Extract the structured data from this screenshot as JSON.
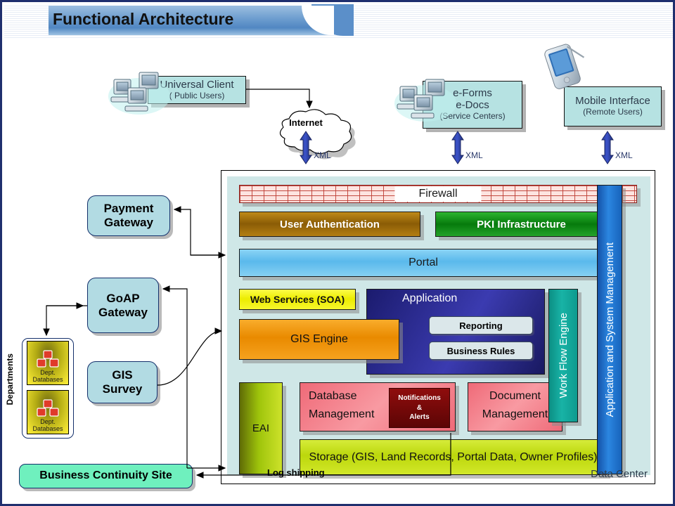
{
  "slide": {
    "title": "Functional Architecture",
    "accent_color": "#5187c2",
    "border_color": "#1f2f6e"
  },
  "actors": [
    {
      "name": "universal-client",
      "line1": "Universal Client",
      "line2": "( Public Users)",
      "icon": "workstations-icon"
    },
    {
      "name": "eforms-edocs",
      "line1": "e-Forms",
      "line1b": "e-Docs",
      "line2": "(Service Centers)",
      "icon": "workstations-icon"
    },
    {
      "name": "mobile-interface",
      "line1": "Mobile Interface",
      "line2": "(Remote Users)",
      "icon": "pda-icon"
    }
  ],
  "internet": {
    "label": "Internet",
    "icon": "cloud-icon"
  },
  "xml_links": [
    {
      "label": "XML"
    },
    {
      "label": "XML"
    },
    {
      "label": "XML"
    }
  ],
  "external_nodes": [
    {
      "name": "payment-gateway",
      "line1": "Payment",
      "line2": "Gateway"
    },
    {
      "name": "goap-gateway",
      "line1": "GoAP",
      "line2": "Gateway"
    },
    {
      "name": "gis-survey",
      "line1": "GIS",
      "line2": "Survey"
    }
  ],
  "departments": {
    "label": "Departments",
    "items": [
      {
        "line1": "Dept.",
        "line2": "Databases",
        "icon": "database-stack-icon"
      },
      {
        "line1": "Dept.",
        "line2": "Databases",
        "icon": "database-stack-icon"
      }
    ]
  },
  "business_continuity": {
    "label": "Business Continuity Site",
    "color": "#6ff0be"
  },
  "log_shipping": {
    "label": "Log shipping"
  },
  "data_center": {
    "label": "Data Center",
    "firewall": {
      "label": "Firewall",
      "color": "#fde4e0"
    },
    "layers": [
      {
        "name": "user-authentication",
        "label": "User Authentication",
        "color": "#9c6b0a"
      },
      {
        "name": "pki-infrastructure",
        "label": "PKI Infrastructure",
        "color": "#0d8a12"
      },
      {
        "name": "portal",
        "label": "Portal",
        "color": "#6ec6f0"
      },
      {
        "name": "web-services-soa",
        "label": "Web Services (SOA)",
        "color": "#f5f500"
      },
      {
        "name": "application",
        "label": "Application",
        "color": "#2a2a8c"
      },
      {
        "name": "gis-engine",
        "label": "GIS Engine",
        "color": "#f09408"
      },
      {
        "name": "eai",
        "label": "EAI",
        "color": "#9ec40b"
      },
      {
        "name": "database-management",
        "label1": "Database",
        "label2": "Management",
        "color": "#f0757f"
      },
      {
        "name": "document-management",
        "label1": "Document",
        "label2": "Management",
        "color": "#f0757f"
      },
      {
        "name": "storage",
        "label": "Storage (GIS, Land Records, Portal Data, Owner Profiles)",
        "color": "#c8e019"
      },
      {
        "name": "work-flow-engine",
        "label": "Work Flow Engine",
        "color": "#12a094"
      },
      {
        "name": "application-system-management",
        "label": "Application and System Management",
        "color": "#1f72d0"
      }
    ],
    "application_children": [
      {
        "name": "reporting",
        "label": "Reporting"
      },
      {
        "name": "business-rules",
        "label": "Business Rules"
      }
    ],
    "notifications": {
      "line1": "Notifications",
      "line2": "&",
      "line3": "Alerts",
      "color": "#7a0a0a"
    }
  }
}
